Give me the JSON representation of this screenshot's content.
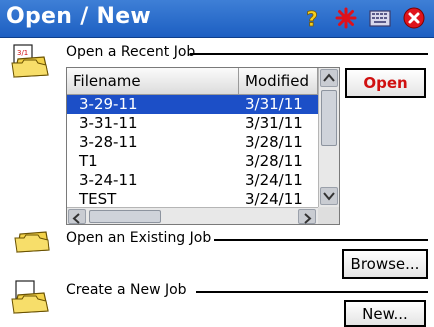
{
  "window": {
    "title": "Open / New"
  },
  "titlebar_icons": [
    "help-icon",
    "settings-star-icon",
    "keyboard-icon",
    "close-icon"
  ],
  "recent": {
    "label": "Open a Recent Job",
    "columns": {
      "filename": "Filename",
      "modified": "Modified"
    },
    "rows": [
      {
        "filename": "3-29-11",
        "modified": "3/31/11",
        "selected": true
      },
      {
        "filename": "3-31-11",
        "modified": "3/31/11"
      },
      {
        "filename": "3-28-11",
        "modified": "3/28/11"
      },
      {
        "filename": "T1",
        "modified": "3/28/11"
      },
      {
        "filename": "3-24-11",
        "modified": "3/24/11"
      },
      {
        "filename": "TEST",
        "modified": "3/24/11"
      }
    ],
    "open_label": "Open"
  },
  "existing": {
    "label": "Open an Existing Job",
    "browse_label": "Browse..."
  },
  "create": {
    "label": "Create a New Job",
    "new_label": "New..."
  },
  "colors": {
    "titlebar": "#1d5fc2",
    "selection": "#1c4fc7",
    "open_text": "#d01010"
  }
}
